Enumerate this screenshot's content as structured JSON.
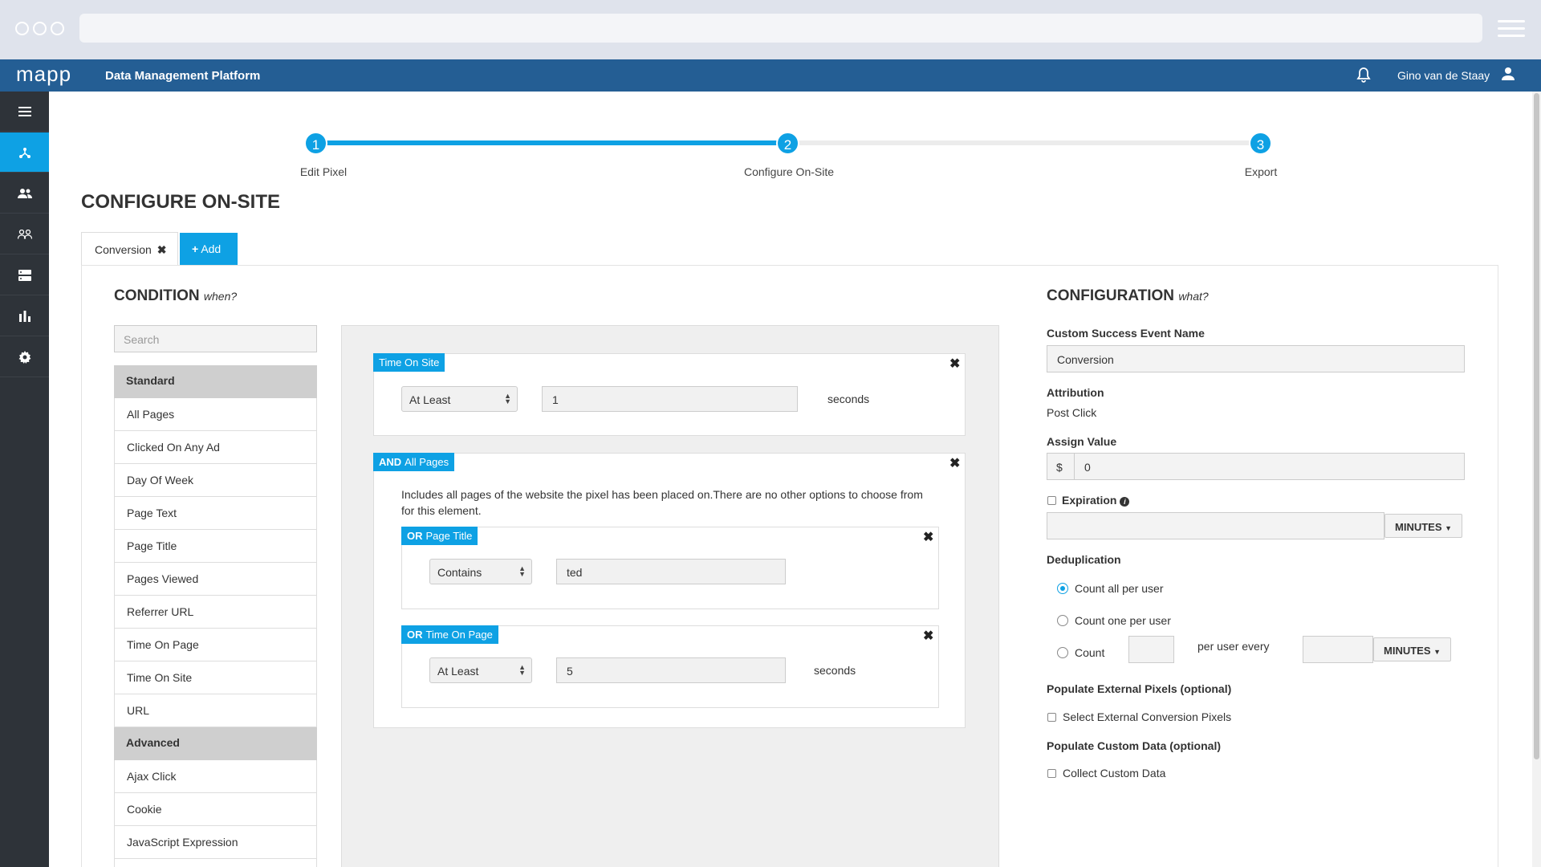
{
  "app": {
    "logo": "mapp",
    "title": "Data Management Platform",
    "user_name": "Gino van de Staay"
  },
  "stepper": {
    "steps": [
      {
        "number": "1",
        "label": "Edit Pixel"
      },
      {
        "number": "2",
        "label": "Configure On-Site"
      },
      {
        "number": "3",
        "label": "Export"
      }
    ]
  },
  "page_title": "CONFIGURE ON-SITE",
  "tabs": {
    "conversion_label": "Conversion",
    "add_label": "Add"
  },
  "condition": {
    "title": "CONDITION",
    "subtitle": "when?",
    "search_placeholder": "Search",
    "standard_label": "Standard",
    "standard_items": [
      "All Pages",
      "Clicked On Any Ad",
      "Day Of Week",
      "Page Text",
      "Page Title",
      "Pages Viewed",
      "Referrer URL",
      "Time On Page",
      "Time On Site",
      "URL"
    ],
    "advanced_label": "Advanced",
    "advanced_items": [
      "Ajax Click",
      "Cookie",
      "JavaScript Expression"
    ]
  },
  "rules": {
    "time_on_site": {
      "tag": "Time On Site",
      "operator": "At Least",
      "value": "1",
      "unit": "seconds"
    },
    "all_pages": {
      "prefix": "AND",
      "tag": "All Pages",
      "description": "Includes all pages of the website the pixel has been placed on.There are no other options to choose from for this element."
    },
    "page_title": {
      "prefix": "OR",
      "tag": "Page Title",
      "operator": "Contains",
      "value": "ted"
    },
    "time_on_page": {
      "prefix": "OR",
      "tag": "Time On Page",
      "operator": "At Least",
      "value": "5",
      "unit": "seconds"
    }
  },
  "configuration": {
    "title": "CONFIGURATION",
    "subtitle": "what?",
    "event_name_label": "Custom Success Event Name",
    "event_name_value": "Conversion",
    "attribution_label": "Attribution",
    "attribution_value": "Post Click",
    "assign_value_label": "Assign Value",
    "currency": "$",
    "assign_value": "0",
    "expiration_label": "Expiration",
    "minutes_label": "MINUTES",
    "dedup_label": "Deduplication",
    "dedup_opt1": "Count all per user",
    "dedup_opt2": "Count one per user",
    "dedup_opt3": "Count",
    "per_user_every": "per user every",
    "ext_pixels_label": "Populate External Pixels (optional)",
    "ext_pixels_option": "Select External Conversion Pixels",
    "custom_data_label": "Populate Custom Data (optional)",
    "custom_data_option": "Collect Custom Data"
  },
  "colors": {
    "accent": "#0ea1e4",
    "topbar": "#245e94",
    "sidebar": "#2e3339"
  }
}
